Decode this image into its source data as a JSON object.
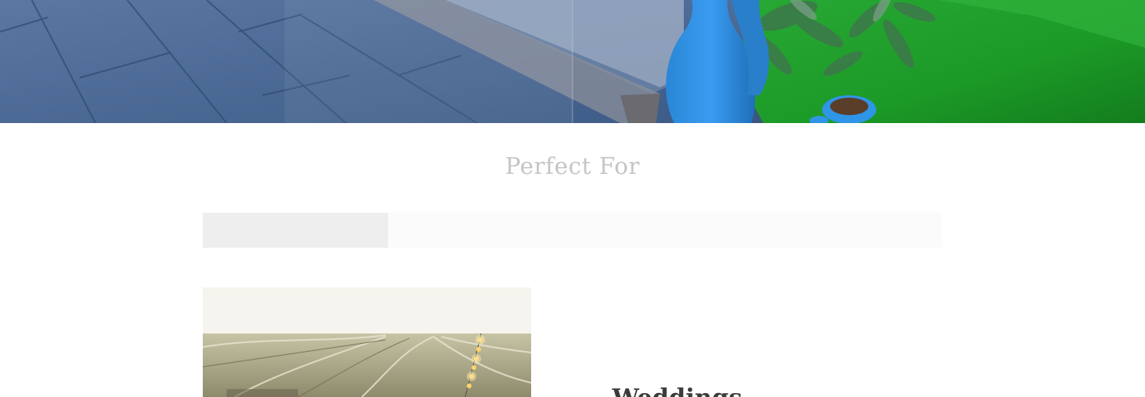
{
  "hero": {
    "scene": "patio-and-garden-photo"
  },
  "section": {
    "title": "Perfect For"
  },
  "tabs": [
    {
      "label": "",
      "active": true
    },
    {
      "label": "",
      "active": false
    },
    {
      "label": "",
      "active": false
    },
    {
      "label": "",
      "active": false
    }
  ],
  "feature": {
    "image": "wedding-tent-photo",
    "heading": "Weddings"
  },
  "colors": {
    "title_text": "#c5c5c5",
    "tab_bar_bg": "#fbfbfb",
    "tab_active_bg": "#eeeeee",
    "heading_text": "#3b3b3b",
    "grass": "#1fa12a",
    "planter_blue": "#2e8fe0"
  }
}
